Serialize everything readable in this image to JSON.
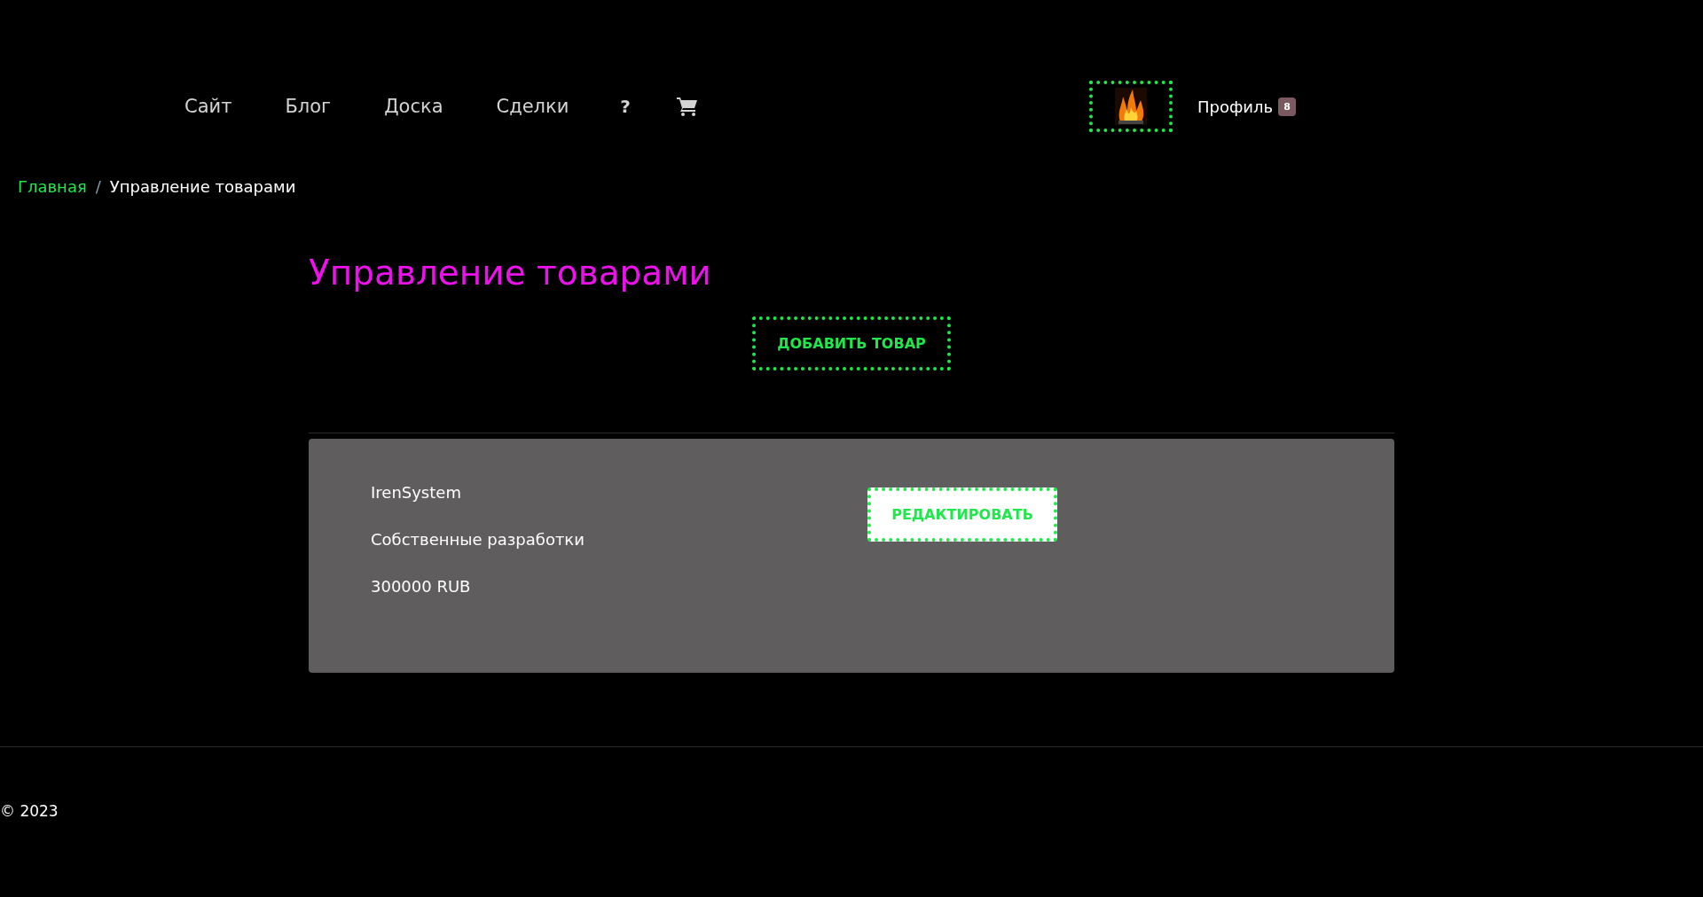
{
  "nav": {
    "links": [
      "Сайт",
      "Блог",
      "Доска",
      "Сделки"
    ],
    "help": "?",
    "profile": {
      "label": "Профиль",
      "badge": "8"
    }
  },
  "breadcrumb": {
    "items": [
      "Главная",
      "Управление товарами"
    ],
    "separator": "/"
  },
  "page_title": "Управление товарами",
  "add_button": "ДОБАВИТЬ ТОВАР",
  "products": [
    {
      "name": "IrenSystem",
      "category": "Собственные разработки",
      "price": "300000 RUB",
      "edit_button": "РЕДАКТИРОВАТЬ"
    }
  ],
  "footer": {
    "copyright": "© 2023"
  }
}
